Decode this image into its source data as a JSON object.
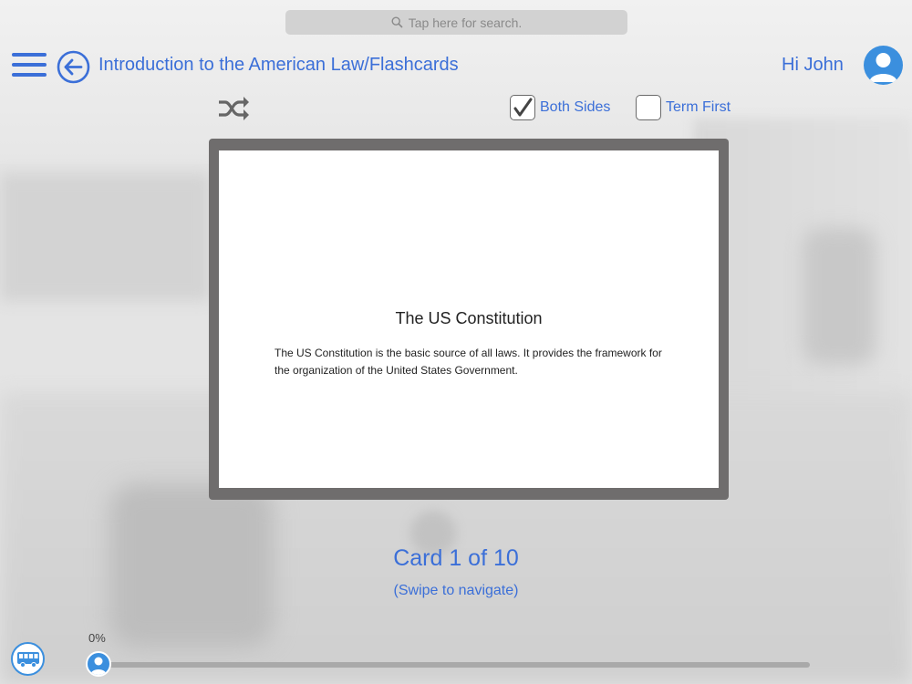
{
  "search": {
    "placeholder": "Tap here for search."
  },
  "header": {
    "title": "Introduction to the American Law/Flashcards",
    "greeting": "Hi John"
  },
  "options": {
    "both_sides": {
      "label": "Both Sides",
      "checked": true
    },
    "term_first": {
      "label": "Term First",
      "checked": false
    }
  },
  "card": {
    "term": "The US Constitution",
    "definition": "The US Constitution is the basic source of all laws. It provides the framework for the organization of the United States Government."
  },
  "navigation": {
    "counter": "Card 1 of 10",
    "hint": "(Swipe to navigate)"
  },
  "progress": {
    "label": "0%",
    "value": 0
  },
  "colors": {
    "accent": "#3b6fd8",
    "avatar": "#3b8fde",
    "card_frame": "#6f6d6d"
  },
  "icons": [
    "hamburger-icon",
    "back-arrow-icon",
    "user-icon",
    "shuffle-icon",
    "checkmark-icon",
    "bus-icon",
    "search-icon"
  ]
}
